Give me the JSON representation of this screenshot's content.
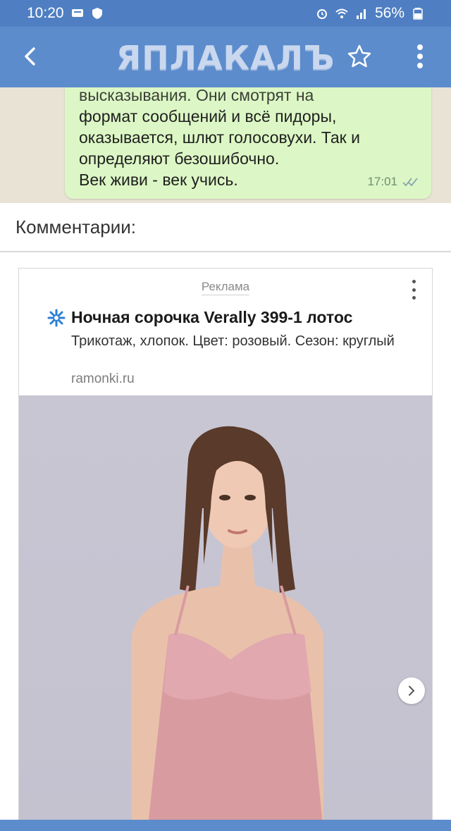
{
  "status_bar": {
    "time": "10:20",
    "battery": "56%"
  },
  "app_bar": {
    "logo_text": "ЯПЛАКАЛЪ"
  },
  "message": {
    "lines": [
      "высказывания. Они смотрят на",
      "формат сообщений и всё пидоры,",
      "оказывается, шлют голосовухи. Так и",
      "определяют безошибочно.",
      "Век живи - век учись."
    ],
    "time": "17:01"
  },
  "comments": {
    "title": "Комментарии:"
  },
  "ad": {
    "label": "Реклама",
    "title": "Ночная сорочка Verally 399-1 лотос",
    "description": "Трикотаж, хлопок. Цвет: розовый. Сезон: круглый",
    "domain": "ramonki.ru"
  },
  "colors": {
    "status_bar": "#4f7fc2",
    "app_bar": "#5c8ccc",
    "bubble": "#dcf7c5",
    "ad_icon": "#2a7fd4"
  }
}
